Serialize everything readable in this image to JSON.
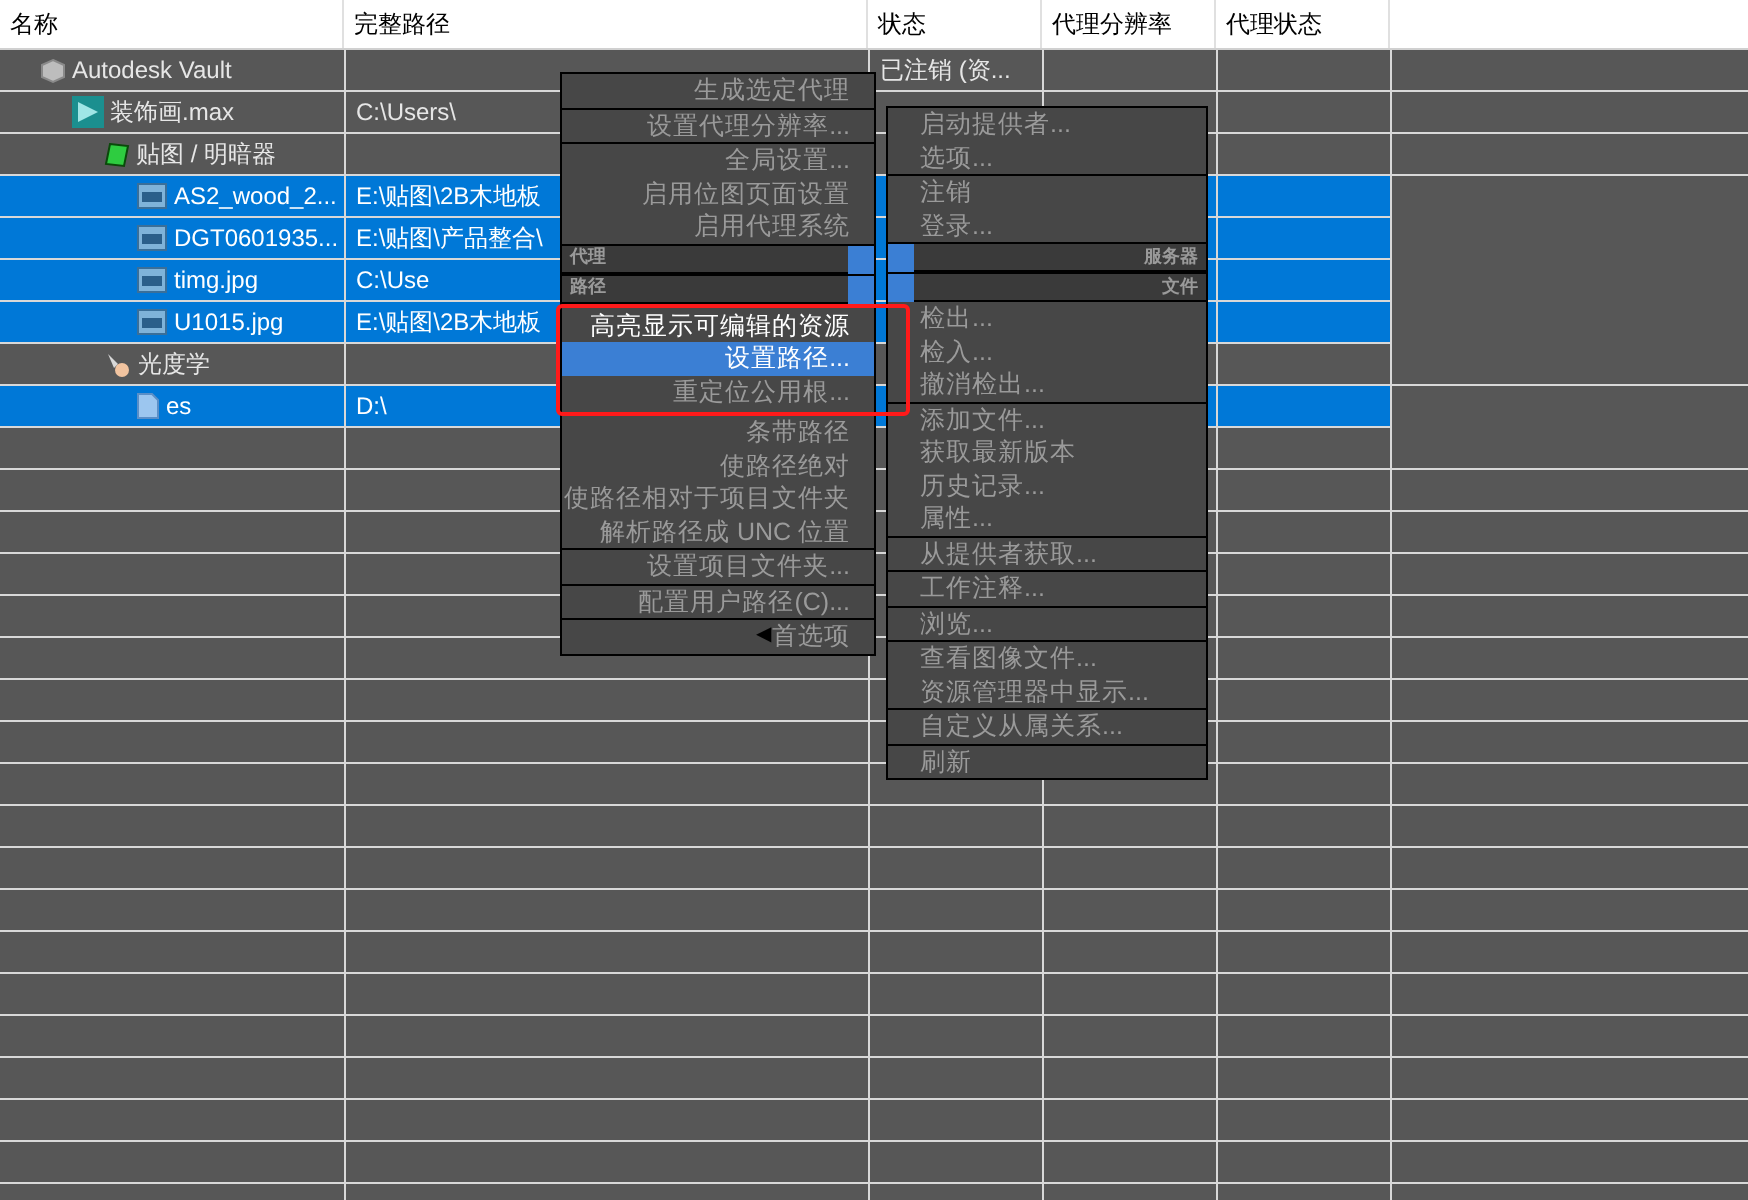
{
  "columns": [
    "名称",
    "完整路径",
    "状态",
    "代理分辨率",
    "代理状态"
  ],
  "tree": [
    {
      "name": "Autodesk Vault",
      "kind": "vault",
      "status": "已注销 (资...",
      "selected": false,
      "children": [
        {
          "name": "装饰画.max",
          "kind": "scene",
          "path": "C:\\Users\\",
          "selected": false,
          "children": [
            {
              "name": "贴图 / 明暗器",
              "kind": "maps",
              "selected": false,
              "children": [
                {
                  "name": "AS2_wood_2...",
                  "kind": "image",
                  "path": "E:\\贴图\\2B木地板",
                  "selected": true
                },
                {
                  "name": "DGT0601935...",
                  "kind": "image",
                  "path": "E:\\贴图\\产品整合\\",
                  "selected": true
                },
                {
                  "name": "timg.jpg",
                  "kind": "image",
                  "path": "C:\\Use",
                  "selected": true
                },
                {
                  "name": "U1015.jpg",
                  "kind": "image",
                  "path": "E:\\贴图\\2B木地板",
                  "selected": true
                }
              ]
            },
            {
              "name": "光度学",
              "kind": "light",
              "selected": false,
              "children": [
                {
                  "name": "es",
                  "kind": "file",
                  "path": "D:\\",
                  "selected": true
                }
              ]
            }
          ]
        }
      ]
    }
  ],
  "left_menu": [
    {
      "items": [
        {
          "label": "生成选定代理",
          "disabled": true,
          "selected": false
        }
      ]
    },
    {
      "items": [
        {
          "label": "设置代理分辨率...",
          "disabled": true,
          "selected": false
        }
      ]
    },
    {
      "items": [
        {
          "label": "全局设置...",
          "disabled": true,
          "selected": false
        },
        {
          "label": "启用位图页面设置",
          "disabled": true,
          "selected": false
        },
        {
          "label": "启用代理系统",
          "disabled": true,
          "selected": false
        }
      ]
    },
    {
      "header": "代理"
    },
    {
      "header": "路径",
      "items": [
        {
          "label": "高亮显示可编辑的资源",
          "disabled": false,
          "selected": false
        },
        {
          "label": "设置路径...",
          "disabled": false,
          "selected": true
        },
        {
          "label": "重定位公用根...",
          "disabled": true,
          "selected": false
        }
      ]
    },
    {
      "items": [
        {
          "label": "条带路径",
          "disabled": true,
          "selected": false
        },
        {
          "label": "使路径绝对",
          "disabled": true,
          "selected": false
        },
        {
          "label": "使路径相对于项目文件夹",
          "disabled": true,
          "selected": false
        },
        {
          "label": "解析路径成 UNC 位置",
          "disabled": true,
          "selected": false
        }
      ]
    },
    {
      "items": [
        {
          "label": "设置项目文件夹...",
          "disabled": true,
          "selected": false
        }
      ]
    },
    {
      "items": [
        {
          "label": "配置用户路径(C)...",
          "disabled": true,
          "selected": false
        }
      ]
    },
    {
      "items": [
        {
          "label": "首选项",
          "disabled": true,
          "selected": false,
          "arrow": "◀"
        }
      ]
    }
  ],
  "right_menu": [
    {
      "items": [
        {
          "label": "启动提供者...",
          "disabled": true,
          "selected": false
        },
        {
          "label": "选项...",
          "disabled": true,
          "selected": false
        }
      ]
    },
    {
      "items": [
        {
          "label": "注销",
          "disabled": true,
          "selected": false
        },
        {
          "label": "登录...",
          "disabled": true,
          "selected": false
        }
      ]
    },
    {
      "header": "服务器"
    },
    {
      "header": "文件",
      "items": [
        {
          "label": "检出...",
          "disabled": true,
          "selected": false
        },
        {
          "label": "检入...",
          "disabled": true,
          "selected": false
        },
        {
          "label": "撤消检出...",
          "disabled": true,
          "selected": false
        }
      ]
    },
    {
      "items": [
        {
          "label": "添加文件...",
          "disabled": true,
          "selected": false
        },
        {
          "label": "获取最新版本",
          "disabled": true,
          "selected": false
        },
        {
          "label": "历史记录...",
          "disabled": true,
          "selected": false
        },
        {
          "label": "属性...",
          "disabled": true,
          "selected": false
        }
      ]
    },
    {
      "items": [
        {
          "label": "从提供者获取...",
          "disabled": true,
          "selected": false
        }
      ]
    },
    {
      "items": [
        {
          "label": "工作注释...",
          "disabled": true,
          "selected": false
        }
      ]
    },
    {
      "items": [
        {
          "label": "浏览...",
          "disabled": true,
          "selected": false
        }
      ]
    },
    {
      "items": [
        {
          "label": "查看图像文件...",
          "disabled": true,
          "selected": false
        },
        {
          "label": "资源管理器中显示...",
          "disabled": true,
          "selected": false
        }
      ]
    },
    {
      "items": [
        {
          "label": "自定义从属关系...",
          "disabled": true,
          "selected": false
        }
      ]
    },
    {
      "items": [
        {
          "label": "刷新",
          "disabled": true,
          "selected": false
        }
      ]
    }
  ]
}
